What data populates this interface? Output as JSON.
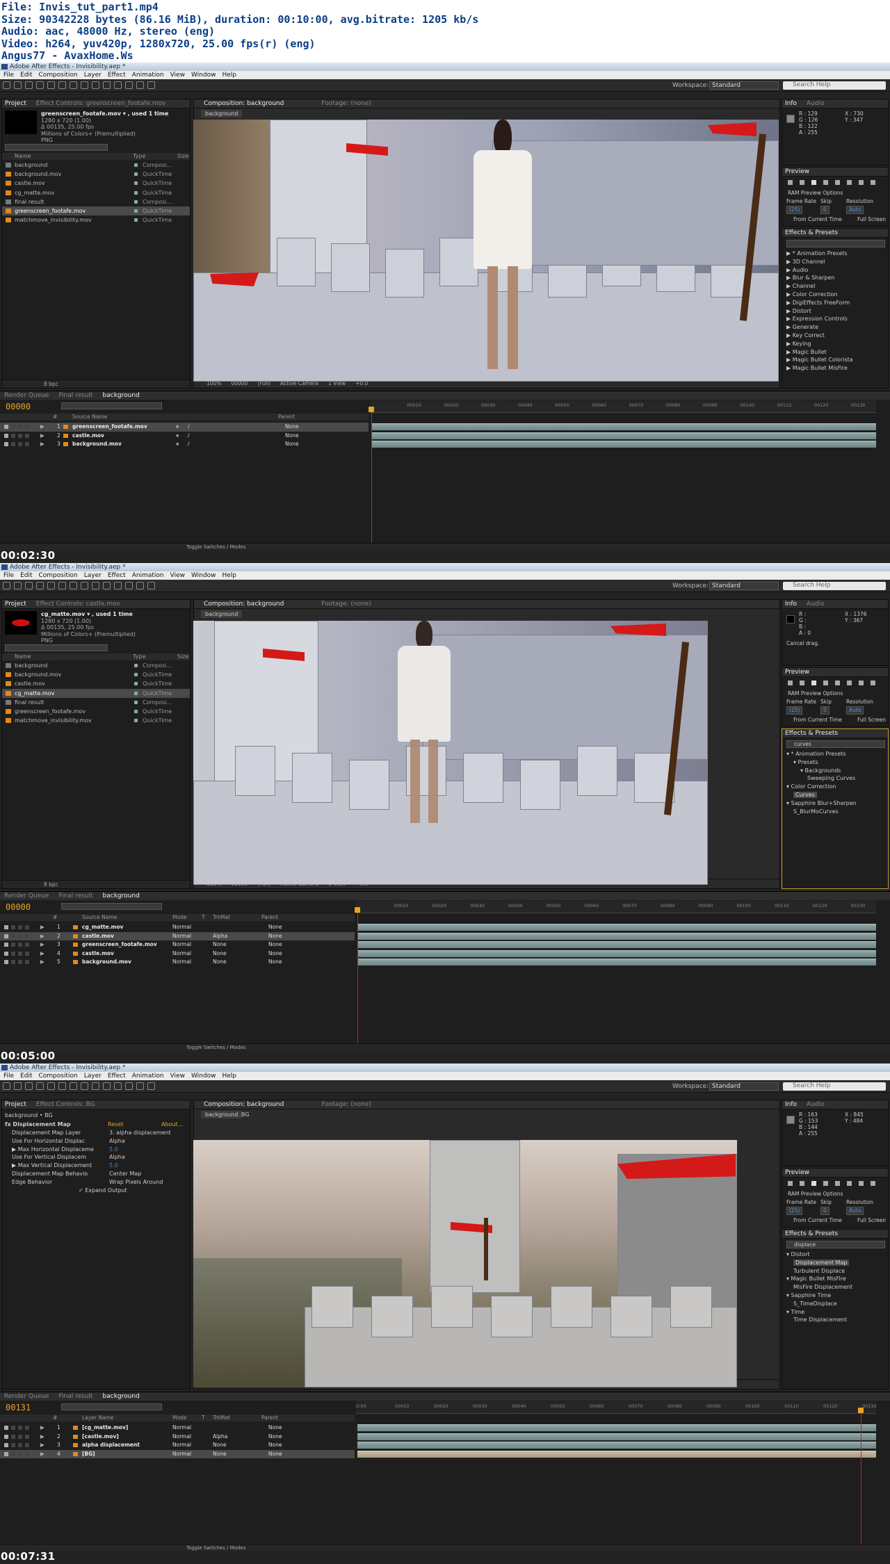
{
  "header": {
    "lines": [
      "File: Invis_tut_part1.mp4",
      "Size: 90342228 bytes (86.16 MiB), duration: 00:10:00, avg.bitrate: 1205 kb/s",
      "Audio: aac, 48000 Hz, stereo (eng)",
      "Video: h264, yuv420p, 1280x720, 25.00 fps(r) (eng)",
      "Angus77 - AvaxHome.Ws"
    ]
  },
  "app": {
    "title": "Adobe After Effects - Invisibility.aep *",
    "menu": [
      "File",
      "Edit",
      "Composition",
      "Layer",
      "Effect",
      "Animation",
      "View",
      "Window",
      "Help"
    ],
    "workspace_label": "Workspace:",
    "workspace_value": "Standard",
    "search_help": "Search Help"
  },
  "frames": [
    {
      "timestamp": "00:02:30",
      "left_tabs": [
        "Project",
        "Effect Controls: greenscreen_footafe.mov"
      ],
      "footage": {
        "name": "greenscreen_footafe.mov ▾ , used 1 time",
        "dims": "1280 x 720 (1.00)",
        "dur": "Δ 00135, 25.00 fps",
        "colors": "Millions of Colors+ (Premultiplied)",
        "codec": "PNG"
      },
      "project_cols": [
        "Name",
        "Type",
        "Size"
      ],
      "project_items": [
        {
          "name": "background",
          "type": "Composi...",
          "orange": false,
          "sel": false
        },
        {
          "name": "background.mov",
          "type": "QuickTime",
          "orange": true,
          "sel": false
        },
        {
          "name": "castle.mov",
          "type": "QuickTime",
          "orange": true,
          "sel": false
        },
        {
          "name": "cg_matte.mov",
          "type": "QuickTime",
          "orange": true,
          "sel": false
        },
        {
          "name": "final result",
          "type": "Composi...",
          "orange": false,
          "sel": false
        },
        {
          "name": "greenscreen_footafe.mov",
          "type": "QuickTime",
          "orange": true,
          "sel": true
        },
        {
          "name": "matchmove_invisibility.mov",
          "type": "QuickTime",
          "orange": true,
          "sel": false
        }
      ],
      "bpc": "8 bpc",
      "comp_tabs": [
        "Composition: background",
        "Footage: (none)"
      ],
      "comp_sub": [
        "background"
      ],
      "viewer_ctrl": [
        "100%",
        "00000",
        "(Full)",
        "Active Camera",
        "1 View",
        "+0.0"
      ],
      "info_tabs": [
        "Info",
        "Audio"
      ],
      "info_lines": [
        "R : 129",
        "G : 126",
        "B : 122",
        "A : 255"
      ],
      "info_xy": [
        "X : 730",
        "Y : 347"
      ],
      "info_extra": "",
      "preview_tab": "Preview",
      "ram_options": "RAM Preview Options",
      "preview_fields": [
        "Frame Rate",
        "Skip",
        "Resolution",
        "(25)",
        "0",
        "Auto"
      ],
      "from_current": "From Current Time",
      "full_screen": "Full Screen",
      "effects_tab": "Effects & Presets",
      "effects_search": "",
      "effects_tree": [
        {
          "t": "▶ * Animation Presets",
          "indent": 0,
          "hl": false
        },
        {
          "t": "▶ 3D Channel",
          "indent": 0,
          "hl": false
        },
        {
          "t": "▶ Audio",
          "indent": 0,
          "hl": false
        },
        {
          "t": "▶ Blur & Sharpen",
          "indent": 0,
          "hl": false
        },
        {
          "t": "▶ Channel",
          "indent": 0,
          "hl": false
        },
        {
          "t": "▶ Color Correction",
          "indent": 0,
          "hl": false
        },
        {
          "t": "▶ DigiEffects FreeForm",
          "indent": 0,
          "hl": false
        },
        {
          "t": "▶ Distort",
          "indent": 0,
          "hl": false
        },
        {
          "t": "▶ Expression Controls",
          "indent": 0,
          "hl": false
        },
        {
          "t": "▶ Generate",
          "indent": 0,
          "hl": false
        },
        {
          "t": "▶ Key Correct",
          "indent": 0,
          "hl": false
        },
        {
          "t": "▶ Keying",
          "indent": 0,
          "hl": false
        },
        {
          "t": "▶ Magic Bullet",
          "indent": 0,
          "hl": false
        },
        {
          "t": "▶ Magic Bullet Colorista",
          "indent": 0,
          "hl": false
        },
        {
          "t": "▶ Magic Bullet MisFire",
          "indent": 0,
          "hl": false
        }
      ],
      "tl_tabs": [
        "Render Queue",
        "Final result",
        "background"
      ],
      "timecode": "00000",
      "layer_cols": [
        "#",
        "Source Name",
        "Parent"
      ],
      "layers": [
        {
          "num": "1",
          "name": "greenscreen_footafe.mov",
          "mode": "",
          "trk": "",
          "parent": "None",
          "sel": true
        },
        {
          "num": "2",
          "name": "castle.mov",
          "mode": "",
          "trk": "",
          "parent": "None",
          "sel": false
        },
        {
          "num": "3",
          "name": "background.mov",
          "mode": "",
          "trk": "",
          "parent": "None",
          "sel": false
        }
      ],
      "ruler_ticks": [
        "00010",
        "00020",
        "00030",
        "00040",
        "00050",
        "00060",
        "00070",
        "00080",
        "00090",
        "00100",
        "00110",
        "00120",
        "00130"
      ],
      "toggle_label": "Toggle Switches / Modes"
    },
    {
      "timestamp": "00:05:00",
      "left_tabs": [
        "Project",
        "Effect Controls: castle.mov"
      ],
      "footage": {
        "name": "cg_matte.mov ▾ , used 1 time",
        "dims": "1280 x 720 (1.00)",
        "dur": "Δ 00135, 25.00 fps",
        "colors": "Millions of Colors+ (Premultiplied)",
        "codec": "PNG"
      },
      "project_cols": [
        "Name",
        "Type",
        "Size"
      ],
      "project_items": [
        {
          "name": "background",
          "type": "Composi...",
          "orange": false,
          "sel": false
        },
        {
          "name": "background.mov",
          "type": "QuickTime",
          "orange": true,
          "sel": false
        },
        {
          "name": "castle.mov",
          "type": "QuickTime",
          "orange": true,
          "sel": false
        },
        {
          "name": "cg_matte.mov",
          "type": "QuickTime",
          "orange": true,
          "sel": true
        },
        {
          "name": "final result",
          "type": "Composi...",
          "orange": false,
          "sel": false
        },
        {
          "name": "greenscreen_footafe.mov",
          "type": "QuickTime",
          "orange": true,
          "sel": false
        },
        {
          "name": "matchmove_invisibility.mov",
          "type": "QuickTime",
          "orange": true,
          "sel": false
        }
      ],
      "bpc": "8 bpc",
      "comp_tabs": [
        "Composition: background",
        "Footage: (none)"
      ],
      "comp_sub": [
        "background"
      ],
      "viewer_ctrl": [
        "100%",
        "00080",
        "(Full)",
        "Active Camera",
        "1 View",
        "+0.0"
      ],
      "info_tabs": [
        "Info",
        "Audio"
      ],
      "info_lines": [
        "R :",
        "G :",
        "B :",
        "A : 0"
      ],
      "info_xy": [
        "X : 1376",
        "Y : 367"
      ],
      "info_extra": "Cancel drag.",
      "preview_tab": "Preview",
      "ram_options": "RAM Preview Options",
      "preview_fields": [
        "Frame Rate",
        "Skip",
        "Resolution",
        "(25)",
        "0",
        "Auto"
      ],
      "from_current": "From Current Time",
      "full_screen": "Full Screen",
      "effects_tab": "Effects & Presets",
      "effects_search": "curves",
      "effects_tree": [
        {
          "t": "▾ * Animation Presets",
          "indent": 0,
          "hl": false
        },
        {
          "t": "▾ Presets",
          "indent": 1,
          "hl": false
        },
        {
          "t": "▾ Backgrounds",
          "indent": 2,
          "hl": false
        },
        {
          "t": "Sweeping Curves",
          "indent": 3,
          "hl": false
        },
        {
          "t": "▾ Color Correction",
          "indent": 0,
          "hl": false
        },
        {
          "t": "Curves",
          "indent": 1,
          "hl": true
        },
        {
          "t": "▾ Sapphire Blur+Sharpen",
          "indent": 0,
          "hl": false
        },
        {
          "t": "S_BlurMoCurves",
          "indent": 1,
          "hl": false
        }
      ],
      "tl_tabs": [
        "Render Queue",
        "Final result",
        "background"
      ],
      "timecode": "00000",
      "layer_cols": [
        "#",
        "Source Name",
        "Mode",
        "T",
        "TrkMat",
        "Parent"
      ],
      "layers": [
        {
          "num": "1",
          "name": "cg_matte.mov",
          "mode": "Normal",
          "trk": "",
          "parent": "None",
          "sel": false
        },
        {
          "num": "2",
          "name": "castle.mov",
          "mode": "Normal",
          "trk": "Alpha",
          "parent": "None",
          "sel": true
        },
        {
          "num": "3",
          "name": "greenscreen_footafe.mov",
          "mode": "Normal",
          "trk": "None",
          "parent": "None",
          "sel": false
        },
        {
          "num": "4",
          "name": "castle.mov",
          "mode": "Normal",
          "trk": "None",
          "parent": "None",
          "sel": false
        },
        {
          "num": "5",
          "name": "background.mov",
          "mode": "Normal",
          "trk": "None",
          "parent": "None",
          "sel": false
        }
      ],
      "ruler_ticks": [
        "00010",
        "00020",
        "00030",
        "00040",
        "00050",
        "00060",
        "00070",
        "00080",
        "00090",
        "00100",
        "00110",
        "00120",
        "00130"
      ],
      "toggle_label": "Toggle Switches / Modes"
    },
    {
      "timestamp": "00:07:31",
      "left_tabs": [
        "Project",
        "Effect Controls: BG"
      ],
      "fx_header": "background • BG",
      "fx_name": "fx Displacement Map",
      "fx_reset": "Reset",
      "fx_about": "About...",
      "fx_props": [
        {
          "k": "Displacement Map Layer",
          "v": "3. alpha displacement"
        },
        {
          "k": "Use For Horizontal Displac",
          "v": "Alpha"
        },
        {
          "k": "▶ Max Horizontal Displaceme",
          "v": "5.0"
        },
        {
          "k": "Use For Vertical Displacem",
          "v": "Alpha"
        },
        {
          "k": "▶ Max Vertical Displacement",
          "v": "5.0"
        },
        {
          "k": "Displacement Map Behavio",
          "v": "Center Map"
        },
        {
          "k": "Edge Behavior",
          "v": "Wrap Pixels Around"
        },
        {
          "k": "",
          "v": "✓ Expand Output"
        }
      ],
      "comp_tabs": [
        "Composition: background",
        "Footage: (none)"
      ],
      "comp_sub": [
        "background",
        "BG"
      ],
      "viewer_ctrl": [
        "100%",
        "00131",
        "(Full)",
        "Active Camera",
        "1 View",
        "+0.0"
      ],
      "info_tabs": [
        "Info",
        "Audio"
      ],
      "info_lines": [
        "R : 163",
        "G : 153",
        "B : 144",
        "A : 255"
      ],
      "info_xy": [
        "X : 845",
        "Y : 484"
      ],
      "info_extra": "",
      "preview_tab": "Preview",
      "ram_options": "RAM Preview Options",
      "preview_fields": [
        "Frame Rate",
        "Skip",
        "Resolution",
        "(25)",
        "0",
        "Auto"
      ],
      "from_current": "From Current Time",
      "full_screen": "Full Screen",
      "effects_tab": "Effects & Presets",
      "effects_search": "displace",
      "effects_tree": [
        {
          "t": "▾ Distort",
          "indent": 0,
          "hl": false
        },
        {
          "t": "Displacement Map",
          "indent": 1,
          "hl": true
        },
        {
          "t": "Turbulent Displace",
          "indent": 1,
          "hl": false
        },
        {
          "t": "▾ Magic Bullet MisFire",
          "indent": 0,
          "hl": false
        },
        {
          "t": "MisFire Displacement",
          "indent": 1,
          "hl": false
        },
        {
          "t": "▾ Sapphire Time",
          "indent": 0,
          "hl": false
        },
        {
          "t": "S_TimeDisplace",
          "indent": 1,
          "hl": false
        },
        {
          "t": "▾ Time",
          "indent": 0,
          "hl": false
        },
        {
          "t": "Time Displacement",
          "indent": 1,
          "hl": false
        }
      ],
      "tl_tabs": [
        "Render Queue",
        "Final result",
        "background"
      ],
      "timecode": "00131",
      "layer_cols": [
        "#",
        "Layer Name",
        "Mode",
        "T",
        "TrkMat",
        "Parent"
      ],
      "layers": [
        {
          "num": "1",
          "name": "[cg_matte.mov]",
          "mode": "Normal",
          "trk": "",
          "parent": "None",
          "sel": false
        },
        {
          "num": "2",
          "name": "[castle.mov]",
          "mode": "Normal",
          "trk": "Alpha",
          "parent": "None",
          "sel": false
        },
        {
          "num": "3",
          "name": "alpha displacement",
          "mode": "Normal",
          "trk": "None",
          "parent": "None",
          "sel": false
        },
        {
          "num": "4",
          "name": "[BG]",
          "mode": "Normal",
          "trk": "None",
          "parent": "None",
          "sel": true
        }
      ],
      "ruler_ticks": [
        "0:00",
        "00010",
        "00020",
        "00030",
        "00040",
        "00050",
        "00060",
        "00070",
        "00080",
        "00090",
        "00100",
        "00110",
        "00120",
        "00130"
      ],
      "toggle_label": "Toggle Switches / Modes"
    }
  ]
}
